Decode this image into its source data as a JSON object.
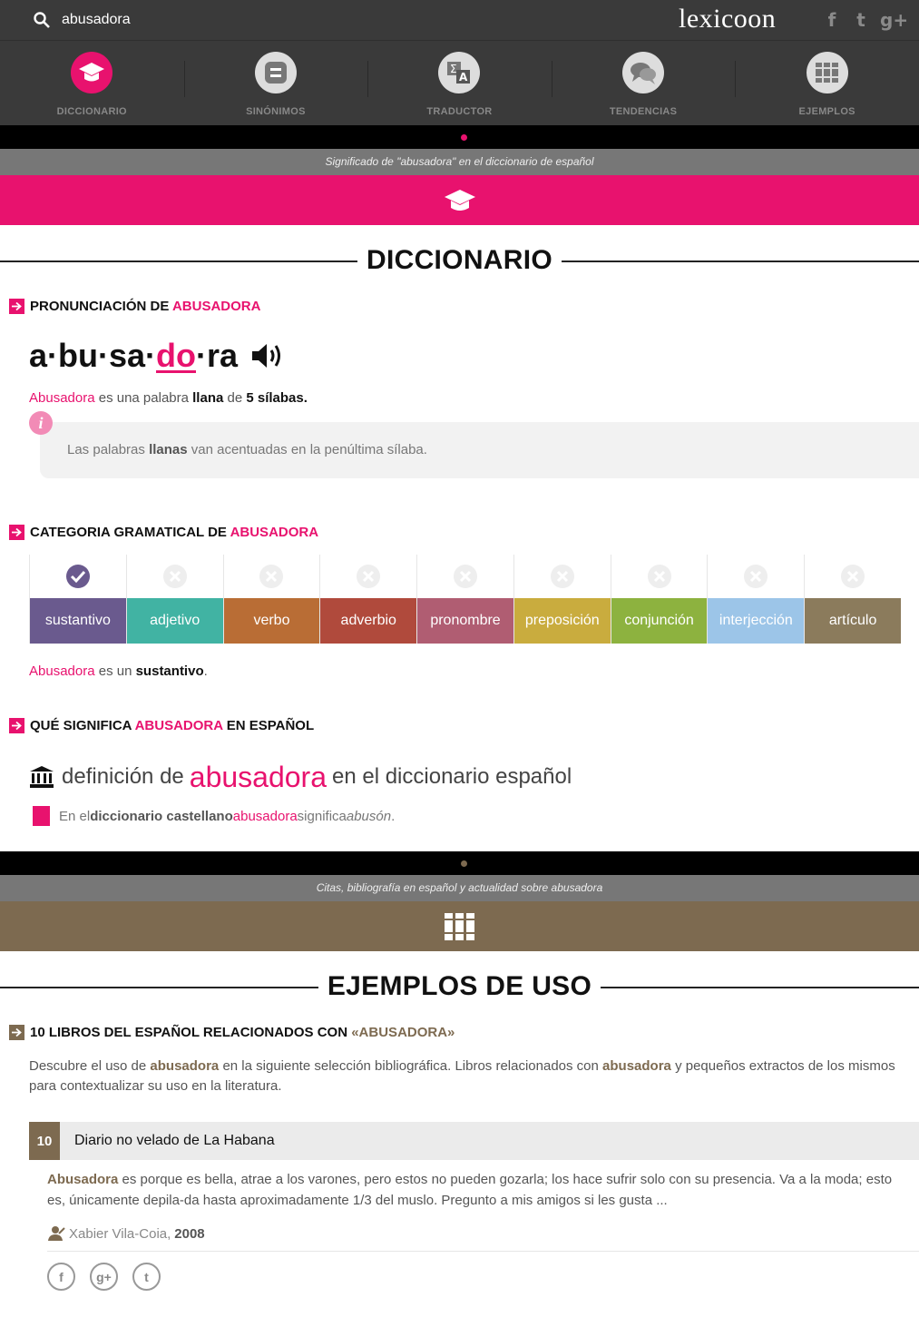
{
  "search": {
    "value": "abusadora"
  },
  "logo": "lexicoon",
  "social": {
    "facebook": "f",
    "twitter": "t",
    "gplus": "g+"
  },
  "nav": [
    {
      "label": "DICCIONARIO",
      "icon": "graduation-cap-icon",
      "active": true
    },
    {
      "label": "SINÓNIMOS",
      "icon": "equals-icon"
    },
    {
      "label": "TRADUCTOR",
      "icon": "translate-icon"
    },
    {
      "label": "TENDENCIAS",
      "icon": "chat-bubbles-icon"
    },
    {
      "label": "EJEMPLOS",
      "icon": "books-icon"
    }
  ],
  "colors": {
    "accent": "#e8126e",
    "brown": "#7d6a50"
  },
  "dictionary": {
    "greybar": "Significado de \"abusadora\" en el diccionario de español",
    "title": "DICCIONARIO",
    "pron_head": "PRONUNCIACIÓN DE",
    "word_upper": "ABUSADORA",
    "syllables": {
      "pre": "a·bu·sa·",
      "stress": "do",
      "post": "·ra"
    },
    "summary": {
      "word": "Abusadora",
      "t1": " es una palabra ",
      "type": "llana",
      "t2": " de ",
      "count": "5 sílabas",
      "t3": "."
    },
    "info": {
      "t1": "Las palabras ",
      "bold": "llanas",
      "t2": " van acentuadas en la penúltima sílaba."
    },
    "cat_head": "CATEGORIA GRAMATICAL DE",
    "categories": [
      {
        "name": "sustantivo",
        "color": "#6a5a8e",
        "checked": true
      },
      {
        "name": "adjetivo",
        "color": "#41b3a3",
        "checked": false
      },
      {
        "name": "verbo",
        "color": "#b96d35",
        "checked": false
      },
      {
        "name": "adverbio",
        "color": "#b04a3c",
        "checked": false
      },
      {
        "name": "pronombre",
        "color": "#b05d72",
        "checked": false
      },
      {
        "name": "preposición",
        "color": "#c9ac3e",
        "checked": false
      },
      {
        "name": "conjunción",
        "color": "#8db23f",
        "checked": false
      },
      {
        "name": "interjección",
        "color": "#9cc5e8",
        "checked": false
      },
      {
        "name": "artículo",
        "color": "#8b7b5c",
        "checked": false
      }
    ],
    "cat_result": {
      "word": "Abusadora",
      "t1": " es un ",
      "cat": "sustantivo",
      "t2": "."
    },
    "mean_head_a": "QUÉ SIGNIFICA",
    "mean_head_b": "EN ESPAÑOL",
    "def_title": {
      "pre": "definición de",
      "word": "abusadora",
      "post": "en el diccionario español"
    },
    "def_item": {
      "t1": "En el ",
      "bold": "diccionario castellano",
      "word": " abusadora",
      "t2": " significa ",
      "meaning": "abusón",
      "t3": "."
    }
  },
  "examples": {
    "greybar": "Citas, bibliografía en español y actualidad sobre abusadora",
    "title": "EJEMPLOS DE USO",
    "books_head": "10 LIBROS DEL ESPAÑOL RELACIONADOS CON",
    "books_word": "«ABUSADORA»",
    "intro": {
      "t1": "Descubre el uso de ",
      "w1": "abusadora",
      "t2": " en la siguiente selección bibliográfica. Libros relacionados con ",
      "w2": "abusadora",
      "t3": " y pequeños extractos de los mismos para contextualizar su uso en la literatura."
    },
    "book": {
      "num": "10",
      "title": "Diario no velado de La Habana",
      "word": "Abusadora",
      "excerpt": " es porque es bella, atrae a los varones, pero estos no pueden gozarla; los hace sufrir solo con su presencia. Va a la moda; esto es, únicamente depila-da hasta aproximadamente 1/3 del muslo. Pregunto a mis amigos si les gusta ...",
      "author": "Xabier Vila-Coia,",
      "year": "2008"
    },
    "shares": [
      "f",
      "g+",
      "t"
    ]
  }
}
